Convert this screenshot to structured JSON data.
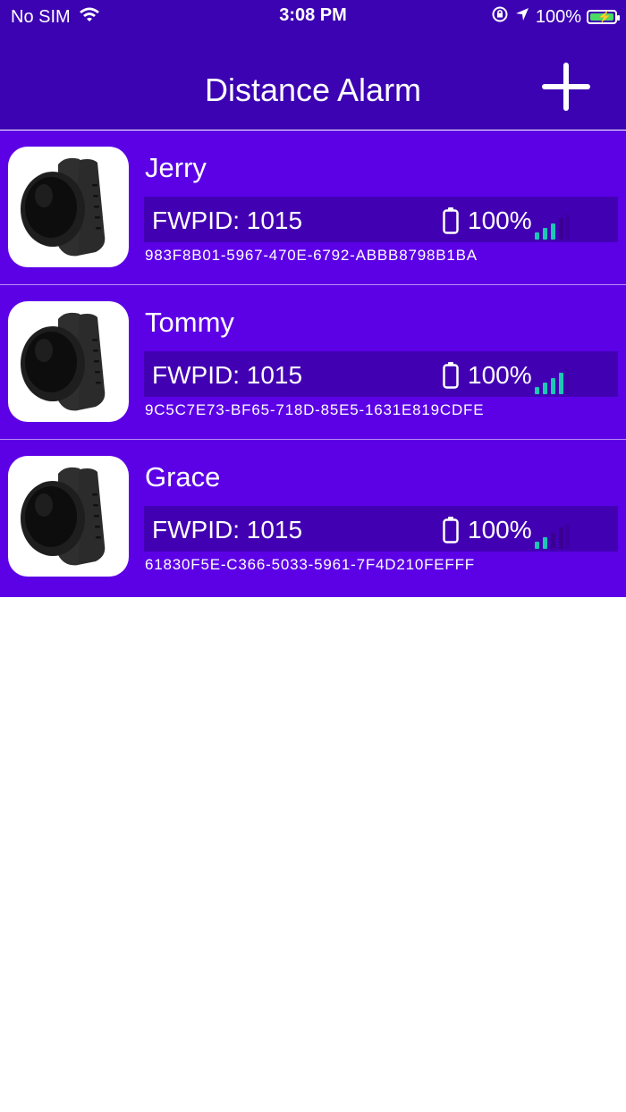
{
  "status_bar": {
    "carrier": "No SIM",
    "time": "3:08 PM",
    "battery_text": "100%"
  },
  "nav": {
    "title": "Distance Alarm",
    "add_icon": "plus-icon"
  },
  "colors": {
    "header": "#3c03b2",
    "row": "#5c00e6",
    "info_bar": "#4200b3",
    "signal_active": "#1fc7b2",
    "signal_inactive": "#3a008f"
  },
  "devices": [
    {
      "name": "Jerry",
      "fwpid": "FWPID: 1015",
      "battery": "100%",
      "uuid": "983F8B01-5967-470E-6792-ABBB8798B1BA",
      "signal_bars": 3
    },
    {
      "name": "Tommy",
      "fwpid": "FWPID: 1015",
      "battery": "100%",
      "uuid": "9C5C7E73-BF65-718D-85E5-1631E819CDFE",
      "signal_bars": 4
    },
    {
      "name": "Grace",
      "fwpid": "FWPID: 1015",
      "battery": "100%",
      "uuid": "61830F5E-C366-5033-5961-7F4D210FEFFF",
      "signal_bars": 2
    }
  ]
}
